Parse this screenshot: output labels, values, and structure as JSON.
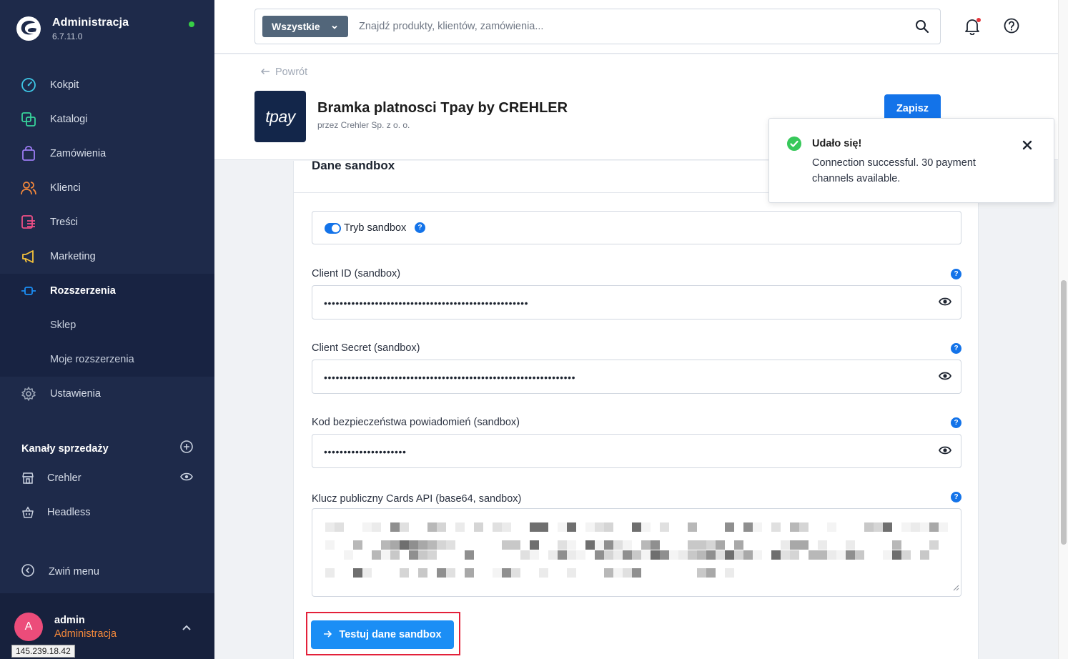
{
  "sidebar": {
    "brand_title": "Administracja",
    "brand_version": "6.7.11.0",
    "items": [
      {
        "label": "Kokpit",
        "icon": "gauge-icon",
        "color": "#3ec7e6"
      },
      {
        "label": "Katalogi",
        "icon": "catalog-icon",
        "color": "#37d39b"
      },
      {
        "label": "Zamówienia",
        "icon": "shopping-bag-icon",
        "color": "#9c7cf4"
      },
      {
        "label": "Klienci",
        "icon": "users-icon",
        "color": "#f3883b"
      },
      {
        "label": "Treści",
        "icon": "content-icon",
        "color": "#ee4f86"
      },
      {
        "label": "Marketing",
        "icon": "megaphone-icon",
        "color": "#f7c33a"
      },
      {
        "label": "Rozszerzenia",
        "icon": "plug-icon",
        "color": "#1b8ef5"
      },
      {
        "label": "Sklep"
      },
      {
        "label": "Moje rozszerzenia"
      },
      {
        "label": "Ustawienia",
        "icon": "gear-icon",
        "color": "#9aa4b5"
      }
    ],
    "channels_title": "Kanały sprzedaży",
    "channels": [
      {
        "label": "Crehler",
        "icon": "storefront-icon"
      },
      {
        "label": "Headless",
        "icon": "basket-icon"
      }
    ],
    "collapse_label": "Zwiń menu",
    "user": {
      "initial": "A",
      "name": "admin",
      "role": "Administracja"
    },
    "ip_tooltip": "145.239.18.42"
  },
  "topbar": {
    "filter_label": "Wszystkie",
    "search_placeholder": "Znajdź produkty, klientów, zamówienia..."
  },
  "page": {
    "back_label": "Powrót",
    "plugin_logo_text": "tpay",
    "plugin_title": "Bramka platnosci Tpay by CREHLER",
    "plugin_vendor": "przez Crehler Sp. z o. o.",
    "save_label": "Zapisz"
  },
  "card": {
    "title": "Dane sandbox",
    "toggle_label": "Tryb sandbox",
    "toggle_on": true,
    "fields": [
      {
        "label": "Client ID (sandbox)",
        "masked": "••••••••••••••••••••••••••••••••••••••••••••••••••••"
      },
      {
        "label": "Client Secret (sandbox)",
        "masked": "••••••••••••••••••••••••••••••••••••••••••••••••••••••••••••••••"
      },
      {
        "label": "Kod bezpieczeństwa powiadomień (sandbox)",
        "masked": "•••••••••••••••••••••"
      }
    ],
    "textarea_label": "Klucz publiczny Cards API (base64, sandbox)",
    "test_button_label": "Testuj dane sandbox"
  },
  "toast": {
    "title": "Udało się!",
    "message": "Connection successful. 30 payment channels available."
  },
  "colors": {
    "sidebar_bg": "#1e2a4a",
    "primary": "#1373e9",
    "accent_button": "#1b8ef5",
    "highlight_outline": "#e3213a",
    "success": "#37c85a"
  }
}
